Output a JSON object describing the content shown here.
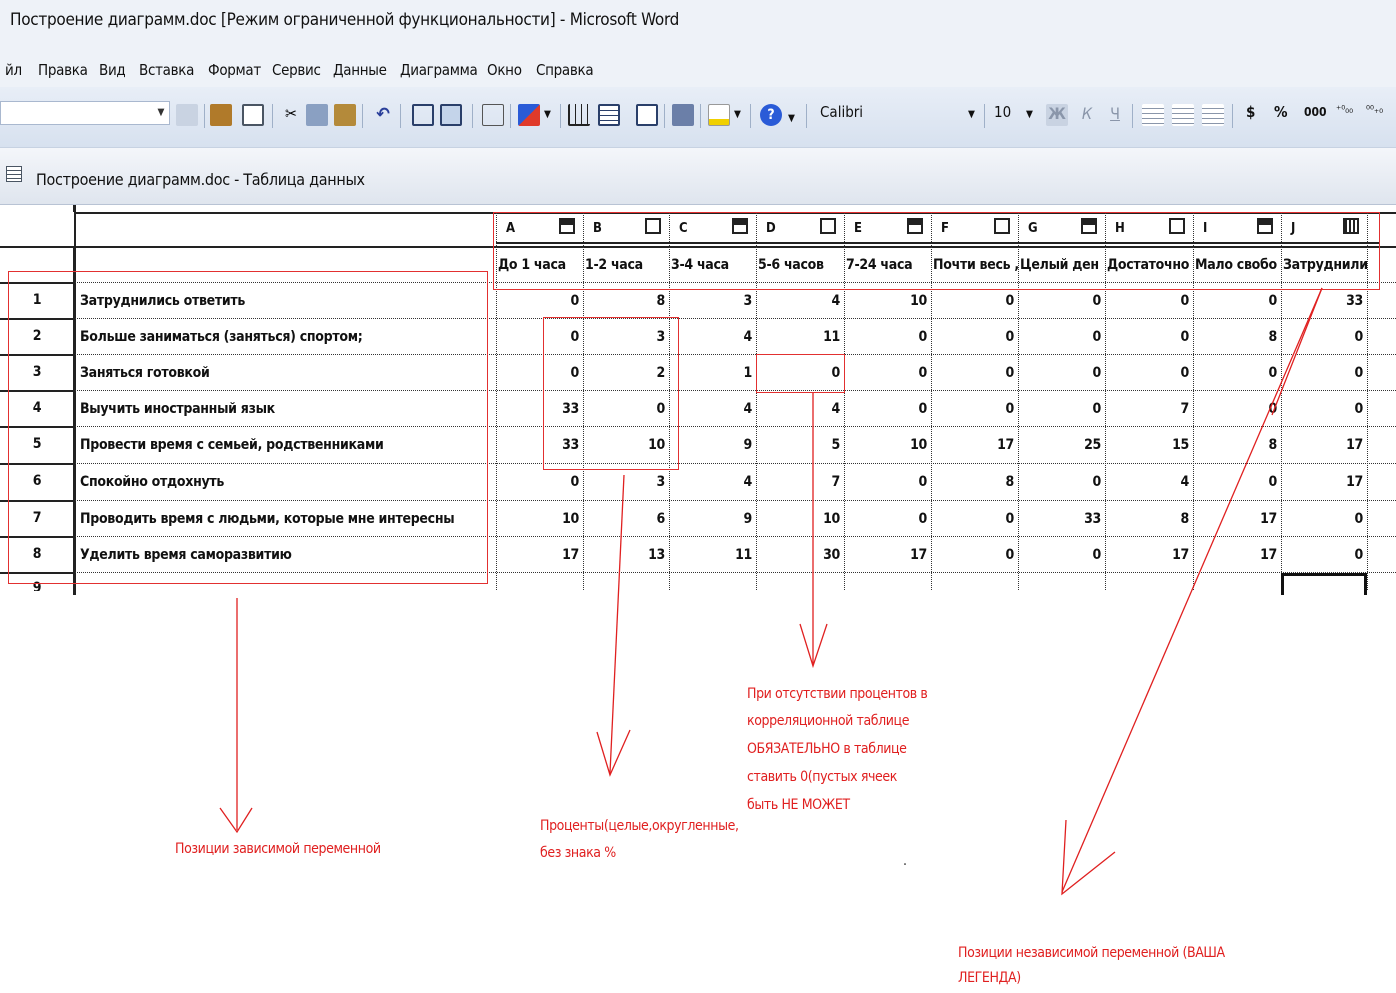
{
  "window": {
    "title": "Построение диаграмм.doc [Режим ограниченной функциональности] - Microsoft Word"
  },
  "menu": [
    {
      "label": "йл"
    },
    {
      "label": "Правка"
    },
    {
      "label": "Вид"
    },
    {
      "label": "Вставка"
    },
    {
      "label": "Формат"
    },
    {
      "label": "Сервис"
    },
    {
      "label": "Данные"
    },
    {
      "label": "Диаграмма"
    },
    {
      "label": "Окно"
    },
    {
      "label": "Справка"
    }
  ],
  "toolbar": {
    "font": "Calibri",
    "size": "10",
    "currency": "$",
    "percent": "%",
    "thousands": "000",
    "inc_decimal": "⁺⁰₀₀",
    "dec_decimal": "⁰⁰₊₀"
  },
  "datasheet": {
    "title": "Построение диаграмм.doc - Таблица данных",
    "column_letters": [
      "A",
      "B",
      "C",
      "D",
      "E",
      "F",
      "G",
      "H",
      "I",
      "J"
    ],
    "column_headers": [
      "До 1 часа",
      "1-2 часа",
      "3-4 часа",
      "5-6 часов",
      "7-24 часа",
      "Почти весь ,",
      "Целый ден",
      "Достаточно",
      "Мало свобо",
      "Затруднились"
    ],
    "rows": [
      {
        "num": "1",
        "label": "Затруднились ответить",
        "values": [
          "0",
          "8",
          "3",
          "4",
          "10",
          "0",
          "0",
          "0",
          "0",
          "33"
        ]
      },
      {
        "num": "2",
        "label": "Больше заниматься (заняться) спортом;",
        "values": [
          "0",
          "3",
          "4",
          "11",
          "0",
          "0",
          "0",
          "0",
          "8",
          "0"
        ]
      },
      {
        "num": "3",
        "label": "Заняться готовкой",
        "values": [
          "0",
          "2",
          "1",
          "0",
          "0",
          "0",
          "0",
          "0",
          "0",
          "0"
        ]
      },
      {
        "num": "4",
        "label": "Выучить иностранный язык",
        "values": [
          "33",
          "0",
          "4",
          "4",
          "0",
          "0",
          "0",
          "7",
          "0",
          "0"
        ]
      },
      {
        "num": "5",
        "label": "Провести время с семьей, родственниками",
        "values": [
          "33",
          "10",
          "9",
          "5",
          "10",
          "17",
          "25",
          "15",
          "8",
          "17"
        ]
      },
      {
        "num": "6",
        "label": "Спокойно отдохнуть",
        "values": [
          "0",
          "3",
          "4",
          "7",
          "0",
          "8",
          "0",
          "4",
          "0",
          "17"
        ]
      },
      {
        "num": "7",
        "label": "Проводить время с людьми, которые мне интересны",
        "values": [
          "10",
          "6",
          "9",
          "10",
          "0",
          "0",
          "33",
          "8",
          "17",
          "0"
        ]
      },
      {
        "num": "8",
        "label": "Уделить время саморазвитию",
        "values": [
          "17",
          "13",
          "11",
          "30",
          "17",
          "0",
          "0",
          "17",
          "17",
          "0"
        ]
      }
    ],
    "next_row": "9"
  },
  "annotations": {
    "dependent": "Позиции зависимой переменной",
    "percent_line1": "Проценты(целые,округленные,",
    "percent_line2": "без знака %",
    "zero_line1": "При отсутствии процентов в",
    "zero_line2": "корреляционной таблице",
    "zero_line3": "ОБЯЗАТЕЛЬНО в таблице",
    "zero_line4": "ставить 0(пустых ячеек",
    "zero_line5": "быть НЕ МОЖЕТ",
    "independent_line1": "Позиции независимой переменной (ВАША",
    "independent_line2": "ЛЕГЕНДА)",
    "dot": "."
  },
  "colors": {
    "accent": "#e02020",
    "chrome": "#eef2f8"
  }
}
